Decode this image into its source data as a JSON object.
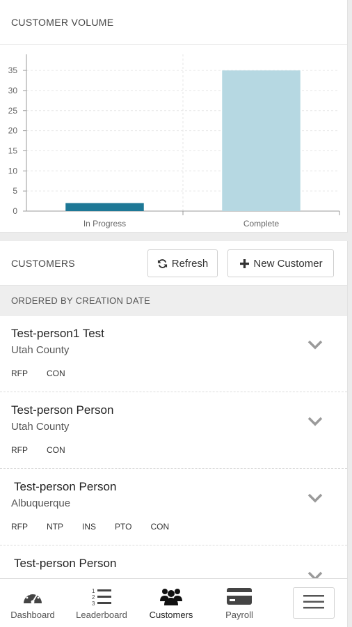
{
  "volume": {
    "title": "CUSTOMER VOLUME"
  },
  "chart_data": {
    "type": "bar",
    "categories": [
      "In Progress",
      "Complete"
    ],
    "values": [
      2,
      35
    ],
    "colors": [
      "#1e7896",
      "#b6d8e2"
    ],
    "y_ticks": [
      0,
      5,
      10,
      15,
      20,
      25,
      30,
      35
    ],
    "ylim": [
      0,
      39
    ],
    "grid": true,
    "title": "",
    "xlabel": "",
    "ylabel": ""
  },
  "customers": {
    "title": "CUSTOMERS",
    "refresh_label": "Refresh",
    "new_customer_label": "New Customer",
    "order_label": "ORDERED BY CREATION DATE",
    "rows": [
      {
        "name": "Test-person1 Test",
        "location": "Utah County",
        "tags": [
          "RFP",
          "CON"
        ]
      },
      {
        "name": "Test-person Person",
        "location": "Utah County",
        "tags": [
          "RFP",
          "CON"
        ]
      },
      {
        "name": "Test-person Person",
        "location": "Albuquerque",
        "tags": [
          "RFP",
          "NTP",
          "INS",
          "PTO",
          "CON"
        ]
      },
      {
        "name": "Test-person Person",
        "location": "",
        "tags": []
      }
    ]
  },
  "nav": {
    "dashboard": "Dashboard",
    "leaderboard": "Leaderboard",
    "customers": "Customers",
    "payroll": "Payroll"
  },
  "colors": {
    "bar_in_progress": "#1e7896",
    "bar_complete": "#b6d8e2",
    "chevron": "#9a9a9a"
  }
}
